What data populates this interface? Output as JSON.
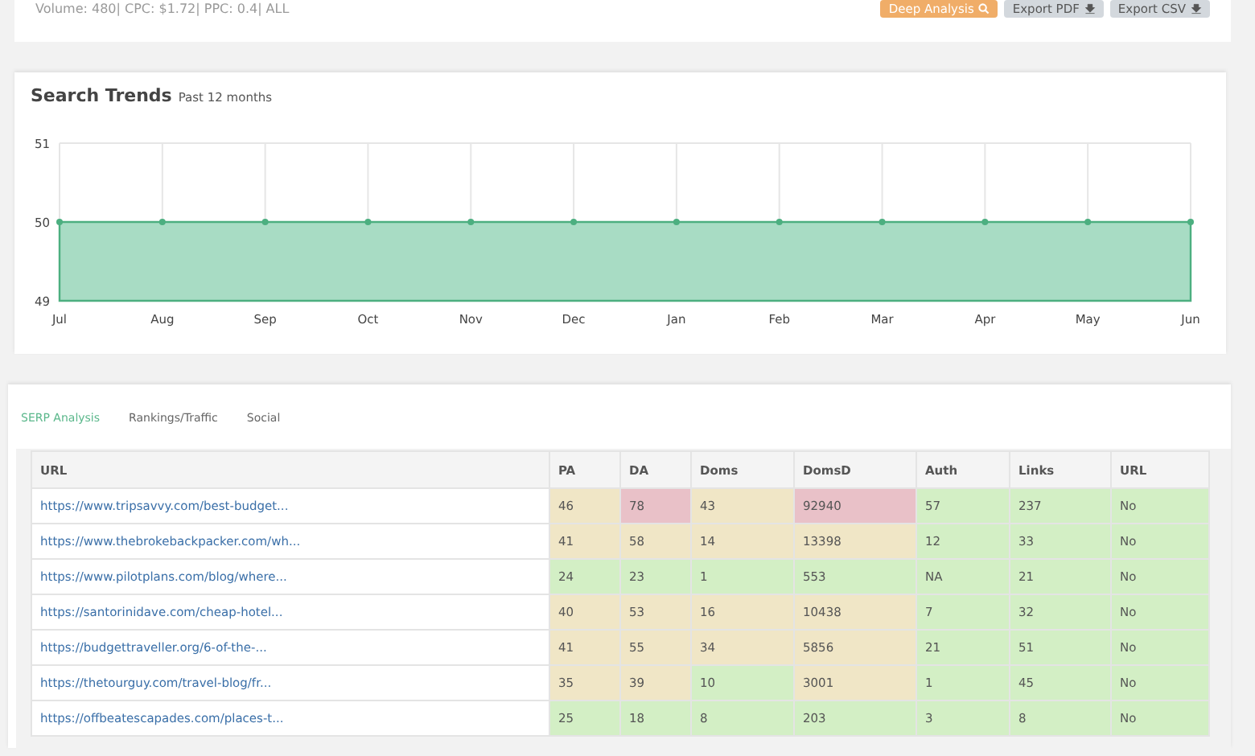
{
  "summary": {
    "text": "Volume: 480| CPC: $1.72| PPC: 0.4| ALL"
  },
  "actions": [
    {
      "label": "Deep Analysis",
      "kind": "primary"
    },
    {
      "label": "Export PDF",
      "kind": "export"
    },
    {
      "label": "Export CSV",
      "kind": "export"
    }
  ],
  "trends": {
    "title": "Search Trends",
    "subtitle": "Past 12 months",
    "chart_data": {
      "type": "area",
      "grid": true,
      "categories": [
        "Jul",
        "Aug",
        "Sep",
        "Oct",
        "Nov",
        "Dec",
        "Jan",
        "Feb",
        "Mar",
        "Apr",
        "May",
        "Jun"
      ],
      "ylim": [
        49,
        51
      ],
      "yticks": [
        49,
        50,
        51
      ],
      "series": [
        {
          "color": "#a8dcc4",
          "values": [
            50,
            50,
            50,
            50,
            50,
            50,
            50,
            50,
            50,
            50,
            50,
            50
          ]
        }
      ]
    }
  },
  "tabs": [
    {
      "label": "SERP Analysis",
      "selected": true
    },
    {
      "label": "Rankings/Traffic",
      "selected": false
    },
    {
      "label": "Social",
      "selected": false
    }
  ],
  "table": {
    "columns": [
      "URL",
      "PA",
      "DA",
      "Doms",
      "DomsD",
      "Auth",
      "Links",
      "URL"
    ],
    "rows": [
      [
        {
          "text": "https://www.tripsavvy.com/best-budget...",
          "kind": "link"
        },
        {
          "text": "46",
          "color": "#f0e6c6"
        },
        {
          "text": "78",
          "color": "#e9c1c8"
        },
        {
          "text": "43",
          "color": "#f0e6c6"
        },
        {
          "text": "92940",
          "color": "#e9c1c8"
        },
        {
          "text": "57",
          "color": "#d3efc5"
        },
        {
          "text": "237",
          "color": "#d3efc5"
        },
        {
          "text": "No",
          "color": "#d3efc5"
        }
      ],
      [
        {
          "text": "https://www.thebrokebackpacker.com/wh...",
          "kind": "link"
        },
        {
          "text": "41",
          "color": "#f0e6c6"
        },
        {
          "text": "58",
          "color": "#f0e6c6"
        },
        {
          "text": "14",
          "color": "#f0e6c6"
        },
        {
          "text": "13398",
          "color": "#f0e6c6"
        },
        {
          "text": "12",
          "color": "#d3efc5"
        },
        {
          "text": "33",
          "color": "#d3efc5"
        },
        {
          "text": "No",
          "color": "#d3efc5"
        }
      ],
      [
        {
          "text": "https://www.pilotplans.com/blog/where...",
          "kind": "link"
        },
        {
          "text": "24",
          "color": "#d3efc5"
        },
        {
          "text": "23",
          "color": "#d3efc5"
        },
        {
          "text": "1",
          "color": "#d3efc5"
        },
        {
          "text": "553",
          "color": "#d3efc5"
        },
        {
          "text": "NA",
          "color": "#d3efc5"
        },
        {
          "text": "21",
          "color": "#d3efc5"
        },
        {
          "text": "No",
          "color": "#d3efc5"
        }
      ],
      [
        {
          "text": "https://santorinidave.com/cheap-hotel...",
          "kind": "link"
        },
        {
          "text": "40",
          "color": "#f0e6c6"
        },
        {
          "text": "53",
          "color": "#f0e6c6"
        },
        {
          "text": "16",
          "color": "#f0e6c6"
        },
        {
          "text": "10438",
          "color": "#f0e6c6"
        },
        {
          "text": "7",
          "color": "#d3efc5"
        },
        {
          "text": "32",
          "color": "#d3efc5"
        },
        {
          "text": "No",
          "color": "#d3efc5"
        }
      ],
      [
        {
          "text": "https://budgettraveller.org/6-of-the-...",
          "kind": "link"
        },
        {
          "text": "41",
          "color": "#f0e6c6"
        },
        {
          "text": "55",
          "color": "#f0e6c6"
        },
        {
          "text": "34",
          "color": "#f0e6c6"
        },
        {
          "text": "5856",
          "color": "#f0e6c6"
        },
        {
          "text": "21",
          "color": "#d3efc5"
        },
        {
          "text": "51",
          "color": "#d3efc5"
        },
        {
          "text": "No",
          "color": "#d3efc5"
        }
      ],
      [
        {
          "text": "https://thetourguy.com/travel-blog/fr...",
          "kind": "link"
        },
        {
          "text": "35",
          "color": "#f0e6c6"
        },
        {
          "text": "39",
          "color": "#f0e6c6"
        },
        {
          "text": "10",
          "color": "#d3efc5"
        },
        {
          "text": "3001",
          "color": "#f0e6c6"
        },
        {
          "text": "1",
          "color": "#d3efc5"
        },
        {
          "text": "45",
          "color": "#d3efc5"
        },
        {
          "text": "No",
          "color": "#d3efc5"
        }
      ],
      [
        {
          "text": "https://offbeatescapades.com/places-t...",
          "kind": "link"
        },
        {
          "text": "25",
          "color": "#d3efc5"
        },
        {
          "text": "18",
          "color": "#d3efc5"
        },
        {
          "text": "8",
          "color": "#d3efc5"
        },
        {
          "text": "203",
          "color": "#d3efc5"
        },
        {
          "text": "3",
          "color": "#d3efc5"
        },
        {
          "text": "8",
          "color": "#d3efc5"
        },
        {
          "text": "No",
          "color": "#d3efc5"
        }
      ]
    ]
  }
}
